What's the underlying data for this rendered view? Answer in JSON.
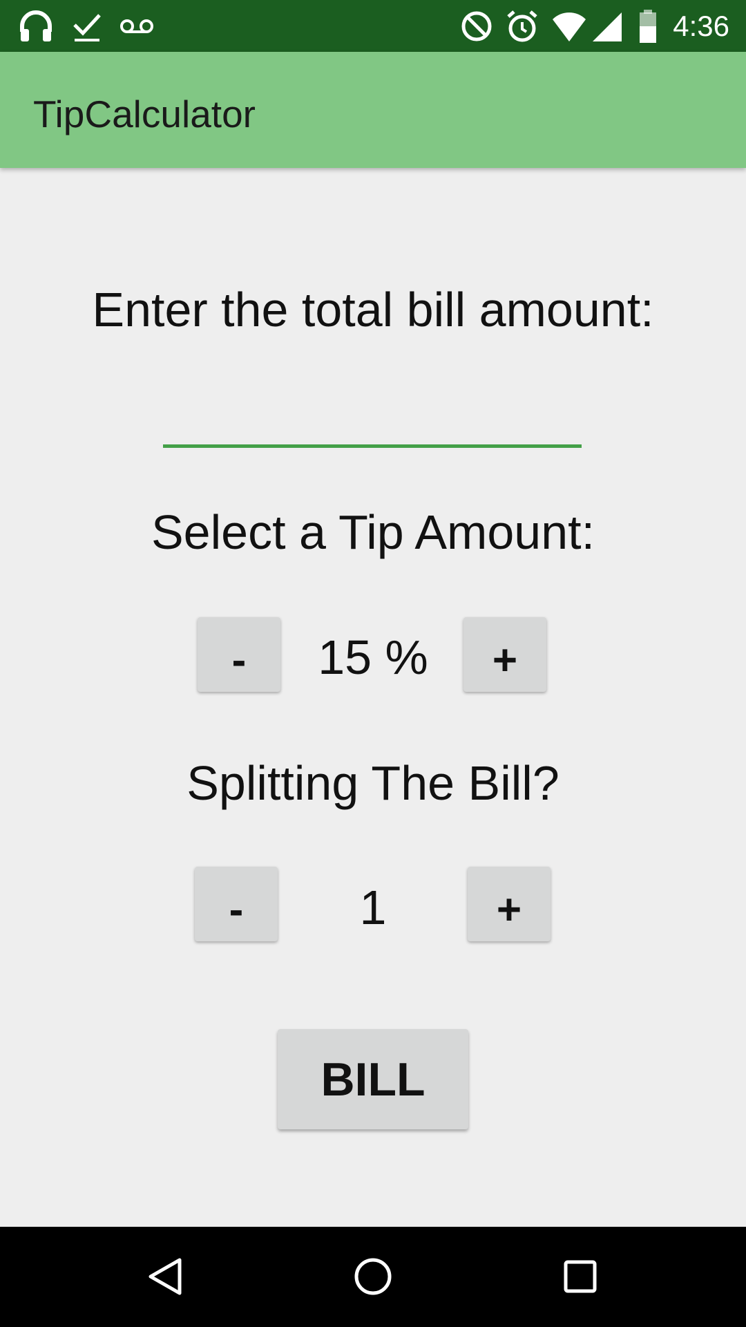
{
  "status_bar": {
    "time": "4:36",
    "background": "#1b5e20",
    "left_icons": [
      "headphones-icon",
      "checkmark-icon",
      "voicemail-icon"
    ],
    "right_icons": [
      "do-not-disturb-icon",
      "alarm-icon",
      "wifi-icon",
      "signal-icon",
      "battery-icon"
    ]
  },
  "app_bar": {
    "title": "TipCalculator",
    "background": "#81c784"
  },
  "bill_section": {
    "label": "Enter the total bill amount:",
    "input_value": "",
    "underline_color": "#43a047"
  },
  "tip_section": {
    "label": "Select a Tip Amount:",
    "decrement_label": "-",
    "value": "15 %",
    "increment_label": "+"
  },
  "split_section": {
    "label": "Splitting The Bill?",
    "decrement_label": "-",
    "value": "1",
    "increment_label": "+"
  },
  "bill_button": {
    "label": "BILL"
  },
  "nav_bar": {
    "buttons": [
      "back-icon",
      "home-icon",
      "recents-icon"
    ]
  }
}
